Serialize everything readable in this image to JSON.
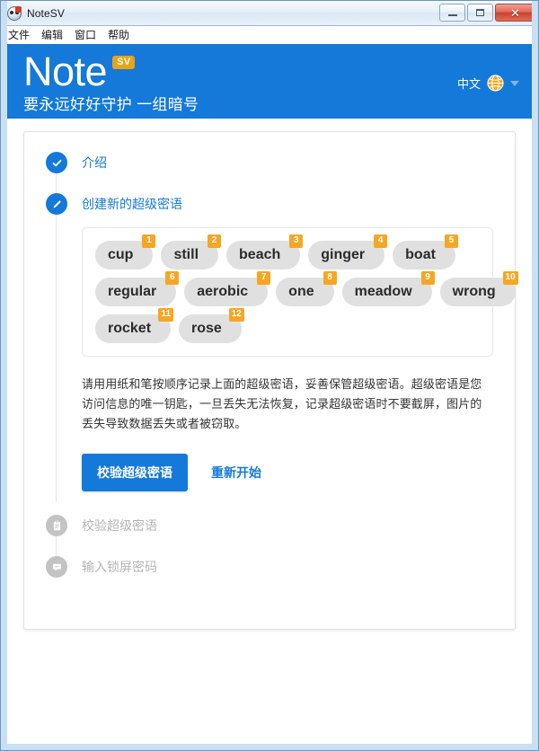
{
  "window": {
    "title": "NoteSV",
    "icon": "app-face-icon",
    "buttons": {
      "minimize": "minimize-icon",
      "maximize": "maximize-icon",
      "close": "✕"
    }
  },
  "menubar": {
    "items": [
      "文件",
      "编辑",
      "窗口",
      "帮助"
    ]
  },
  "banner": {
    "brand": "Note",
    "badge": "SV",
    "tagline": "要永远好好守护 一组暗号",
    "language": {
      "label": "中文",
      "icon": "globe-icon",
      "caret": "chevron-down-icon"
    },
    "color": "#1479d9"
  },
  "steps": [
    {
      "label": "介绍",
      "state": "done",
      "icon": "check-icon"
    },
    {
      "label": "创建新的超级密语",
      "state": "active",
      "icon": "pencil-icon"
    },
    {
      "label": "校验超级密语",
      "state": "pending",
      "icon": "clipboard-icon"
    },
    {
      "label": "输入锁屏密码",
      "state": "pending",
      "icon": "keypad-icon"
    }
  ],
  "recovery_phrase": {
    "rows": [
      [
        {
          "n": "1",
          "word": "cup"
        },
        {
          "n": "2",
          "word": "still"
        },
        {
          "n": "3",
          "word": "beach"
        },
        {
          "n": "4",
          "word": "ginger"
        },
        {
          "n": "5",
          "word": "boat"
        }
      ],
      [
        {
          "n": "6",
          "word": "regular"
        },
        {
          "n": "7",
          "word": "aerobic"
        },
        {
          "n": "8",
          "word": "one"
        },
        {
          "n": "9",
          "word": "meadow"
        },
        {
          "n": "10",
          "word": "wrong"
        }
      ],
      [
        {
          "n": "11",
          "word": "rocket"
        },
        {
          "n": "12",
          "word": "rose"
        }
      ]
    ],
    "badge_color": "#f5a623",
    "chip_color": "#e0e0e0"
  },
  "notice": "请用用纸和笔按顺序记录上面的超级密语，妥善保管超级密语。超级密语是您访问信息的唯一钥匙，一旦丢失无法恢复，记录超级密语时不要截屏，图片的丢失导致数据丢失或者被窃取。",
  "actions": {
    "primary": "校验超级密语",
    "secondary": "重新开始"
  }
}
